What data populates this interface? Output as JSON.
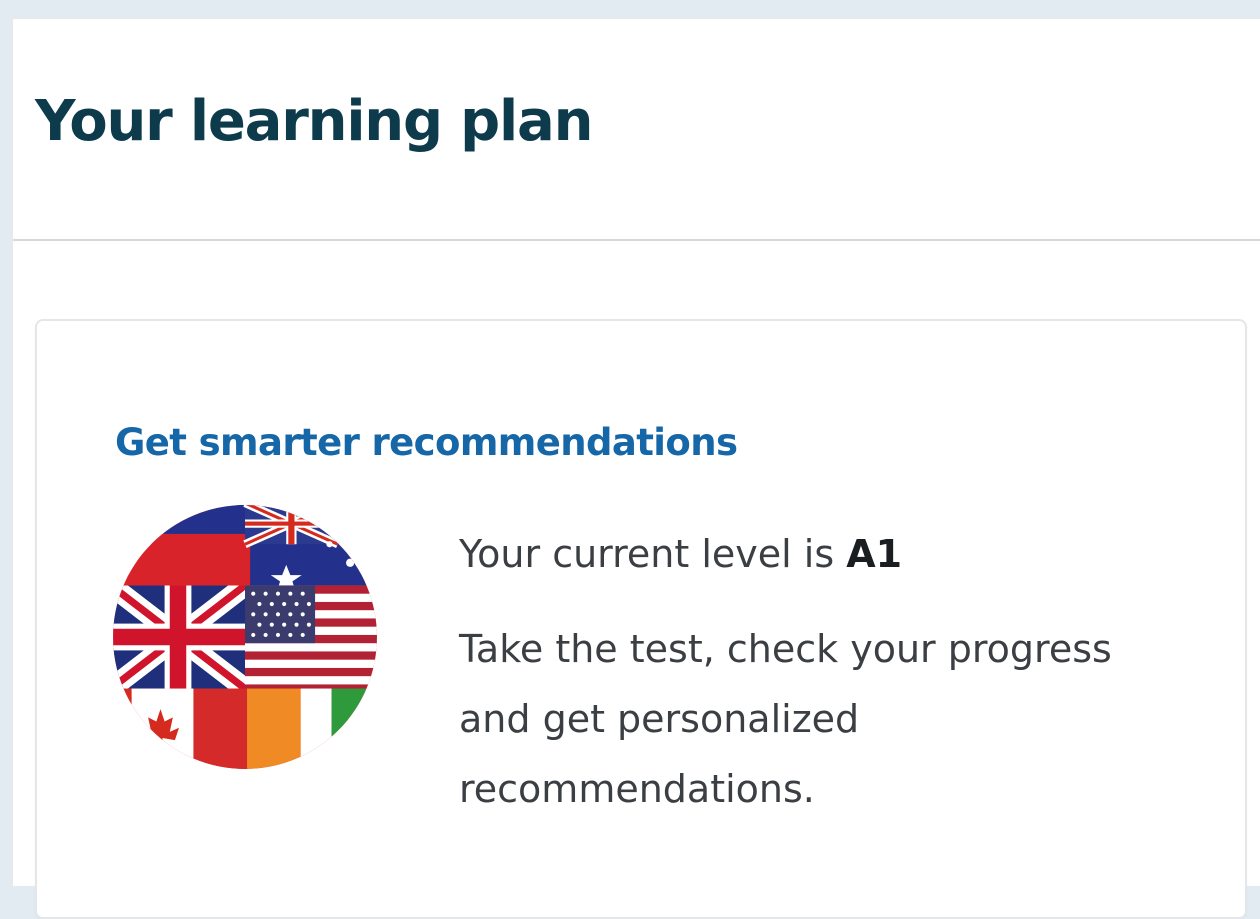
{
  "page": {
    "title": "Your learning plan"
  },
  "recommendation_card": {
    "heading": "Get smarter recommendations",
    "level_prefix": "Your current level is",
    "level_value": "A1",
    "description": "Take the test, check your progress and get personalized recommendations.",
    "icon": "language-flags-globe-icon"
  },
  "colors": {
    "title": "#0d3b4c",
    "heading": "#1567a8",
    "background": "#e3ebf2"
  }
}
